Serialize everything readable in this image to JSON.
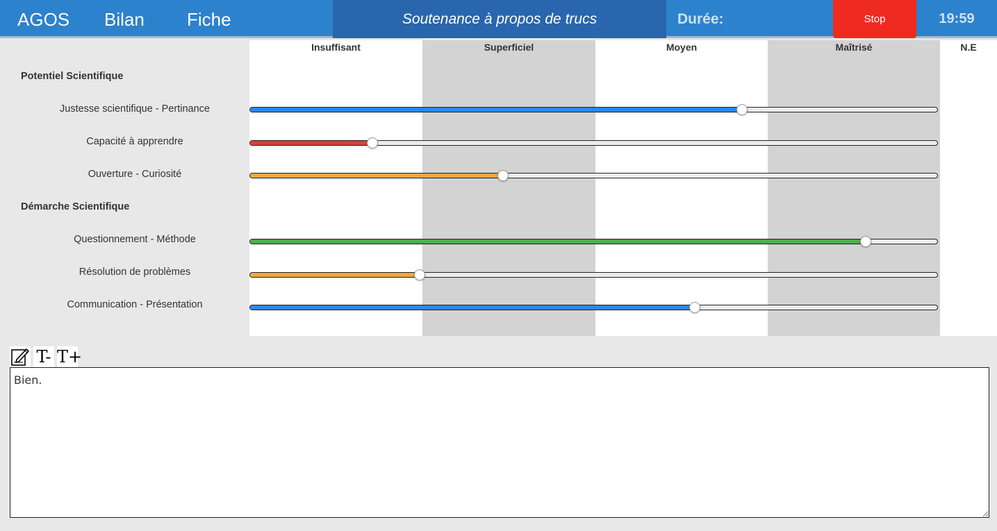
{
  "nav": {
    "items": [
      {
        "label": "AGOS"
      },
      {
        "label": "Bilan"
      },
      {
        "label": "Fiche"
      }
    ]
  },
  "header": {
    "title": "Soutenance à propos de trucs",
    "duration_label": "Durée:",
    "stop_label": "Stop",
    "timer": "19:59"
  },
  "columns": [
    {
      "label": "Insuffisant"
    },
    {
      "label": "Superficiel"
    },
    {
      "label": "Moyen"
    },
    {
      "label": "Maîtrisé"
    },
    {
      "label": "N.E"
    }
  ],
  "sections": [
    {
      "label": "Potentiel Scientifique",
      "criteria": [
        {
          "label": "Justesse scientifique - Pertinance",
          "value": 0.716,
          "color": "#2b87f0"
        },
        {
          "label": "Capacité à apprendre",
          "value": 0.178,
          "color": "#d84040"
        },
        {
          "label": "Ouverture - Curiosité",
          "value": 0.368,
          "color": "#f0a840"
        }
      ]
    },
    {
      "label": "Démarche Scientifique",
      "criteria": [
        {
          "label": "Questionnement - Méthode",
          "value": 0.896,
          "color": "#4cae4c"
        },
        {
          "label": "Résolution de problèmes",
          "value": 0.247,
          "color": "#f0a840"
        },
        {
          "label": "Communication - Présentation",
          "value": 0.647,
          "color": "#2b87f0"
        }
      ]
    }
  ],
  "toolbar": {
    "icons": [
      "edit-note-icon",
      "text-decrease-icon",
      "text-increase-icon"
    ],
    "text_decrease": "T-",
    "text_increase": "T+"
  },
  "comment": {
    "value": "Bien."
  },
  "colors": {
    "header_bg": "#2c82cd",
    "title_bg": "#2966ae",
    "stop_bg": "#ef2b21",
    "column_alt_bg": "#d3d3d3"
  }
}
